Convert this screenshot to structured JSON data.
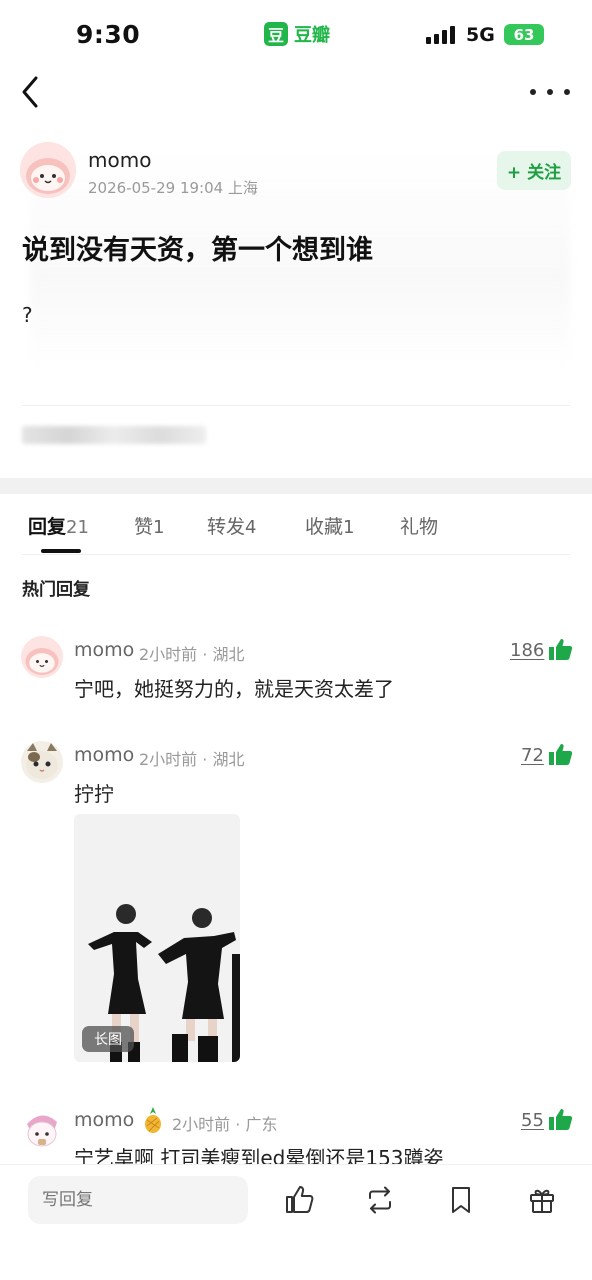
{
  "status_bar": {
    "time": "9:30",
    "app_icon_char": "豆",
    "app_name": "豆瓣",
    "network": "5G",
    "battery": "63"
  },
  "post": {
    "author": "momo",
    "meta": "2026-05-29 19:04 上海",
    "follow_label": "+ 关注",
    "title": "说到没有天资，第一个想到谁",
    "body": "?"
  },
  "tabs": [
    {
      "label": "回复",
      "count": "21"
    },
    {
      "label": "赞",
      "count": "1"
    },
    {
      "label": "转发",
      "count": "4"
    },
    {
      "label": "收藏",
      "count": "1"
    },
    {
      "label": "礼物",
      "count": ""
    }
  ],
  "hot_label": "热门回复",
  "comments": [
    {
      "name": "momo",
      "meta": "2小时前 · 湖北",
      "likes": "186",
      "text": "宁吧，她挺努力的，就是天资太差了"
    },
    {
      "name": "momo",
      "meta": "2小时前 · 湖北",
      "likes": "72",
      "text": "拧拧",
      "image_tag": "长图"
    },
    {
      "name": "momo",
      "meta": "2小时前 · 广东",
      "likes": "55",
      "text": "宁艺卓啊 打司美瘦到ed晕倒还是153蹲姿"
    }
  ],
  "bottom_bar": {
    "reply_placeholder": "写回复"
  },
  "colors": {
    "accent_green": "#21b64a",
    "follow_bg": "#e6f6ea",
    "like_green": "#1fa84a"
  }
}
